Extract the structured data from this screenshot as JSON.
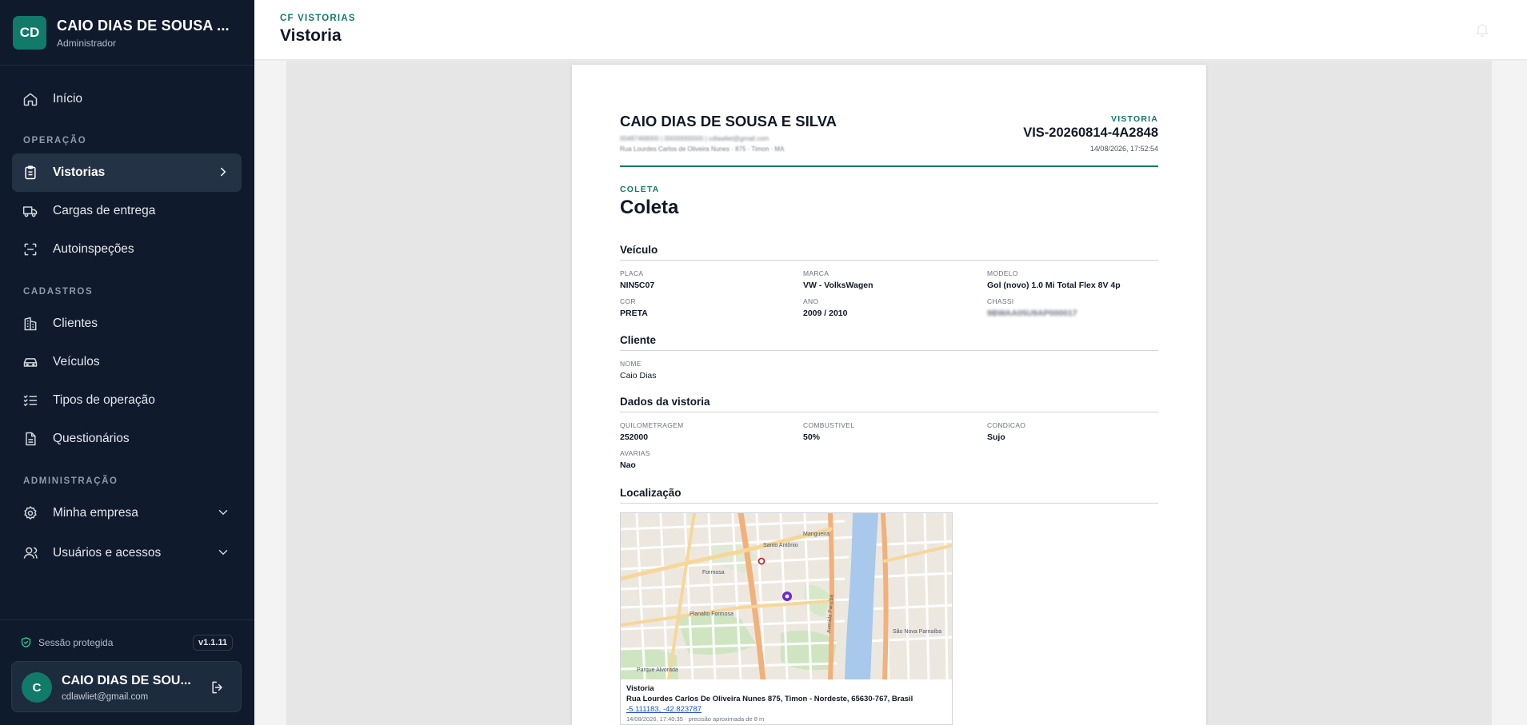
{
  "sidebar": {
    "brand": {
      "initials": "CD",
      "name": "CAIO DIAS DE SOUSA ...",
      "role": "Administrador"
    },
    "nav": {
      "home": "Início",
      "section_operacao": "OPERAÇÃO",
      "vistorias": "Vistorias",
      "cargas": "Cargas de entrega",
      "autoinspecoes": "Autoinspeções",
      "section_cadastros": "CADASTROS",
      "clientes": "Clientes",
      "veiculos": "Veículos",
      "tipos": "Tipos de operação",
      "questionarios": "Questionários",
      "section_admin": "ADMINISTRAÇÃO",
      "empresa": "Minha empresa",
      "usuarios": "Usuários e acessos"
    },
    "session_label": "Sessão protegida",
    "version": "v1.1.11",
    "user": {
      "initial": "C",
      "name": "CAIO DIAS DE SOU...",
      "email": "cdlawliet@gmail.com"
    }
  },
  "header": {
    "eyebrow": "CF VISTORIAS",
    "title": "Vistoria"
  },
  "document": {
    "company": "CAIO DIAS DE SOUSA E SILVA",
    "company_contact": "00487469000 | 00000000000 | cdlawliet@gmail.com",
    "company_address": "Rua Lourdes Carlos de Oliveira Nunes · 875 · Timon · MA",
    "eyebrow": "VISTORIA",
    "code": "VIS-20260814-4A2848",
    "datetime": "14/08/2026, 17:52:54",
    "kind_eyebrow": "COLETA",
    "kind": "Coleta",
    "veiculo": {
      "title": "Veículo",
      "placa_label": "PLACA",
      "placa": "NIN5C07",
      "marca_label": "MARCA",
      "marca": "VW - VolksWagen",
      "modelo_label": "MODELO",
      "modelo": "Gol (novo) 1.0 Mi Total Flex 8V 4p",
      "cor_label": "COR",
      "cor": "PRETA",
      "ano_label": "ANO",
      "ano": "2009 / 2010",
      "chassi_label": "CHASSI",
      "chassi": "9BWAA05U9AP000017"
    },
    "cliente": {
      "title": "Cliente",
      "nome_label": "NOME",
      "nome": "Caio Dias"
    },
    "dados": {
      "title": "Dados da vistoria",
      "km_label": "QUILOMETRAGEM",
      "km": "252000",
      "comb_label": "COMBUSTIVEL",
      "comb": "50%",
      "cond_label": "CONDICAO",
      "cond": "Sujo",
      "avarias_label": "AVARIAS",
      "avarias": "Nao"
    },
    "localizacao": {
      "title": "Localização",
      "map_labels": {
        "santo_antonio": "Santo Antônio",
        "mangueira": "Mangueira",
        "formosa": "Formosa",
        "planalto": "Planalto Formosa",
        "parque_alvorada": "Parque Alvorada",
        "avenida_paraiba": "Avenida Paraíba",
        "sao_nova": "São Nova Parnaíba"
      },
      "caption_title": "Vistoria",
      "caption_address": "Rua Lourdes Carlos De Oliveira Nunes 875, Timon - Nordeste, 65630-767, Brasil",
      "caption_coords": "-5.111183, -42.823787",
      "caption_meta": "14/08/2026, 17:40:35 · precisão aproximada de 8 m"
    }
  },
  "colors": {
    "sidebar_bg": "#0f1b2d",
    "accent": "#127a68",
    "active_item": "#243245",
    "river": "#a8c8ec",
    "marker": "#6d28d9"
  }
}
